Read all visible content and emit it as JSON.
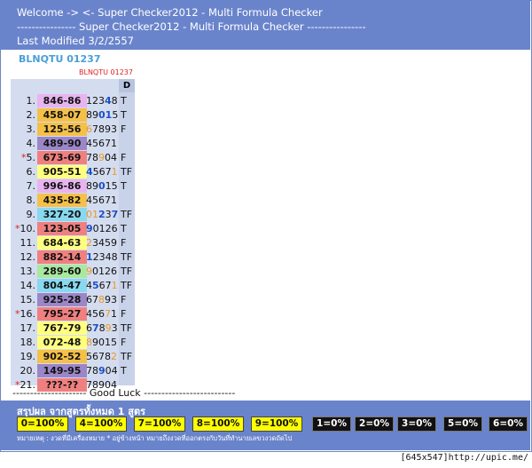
{
  "header": {
    "line1": "Welcome -> <- Super Checker2012 - Multi Formula Checker",
    "line2": "---------------- Super Checker2012 - Multi Formula Checker ----------------",
    "line3": "Last Modified 3/2/2557"
  },
  "formula_id": "BLNQTU 01237",
  "formula_id_small": "BLNQTU 01237",
  "column_header": "D",
  "rows": [
    {
      "n": "1.",
      "star": "",
      "pair": "846-86",
      "color": "#e8b4f0",
      "d": [
        "1",
        "2",
        "3",
        "4",
        "8"
      ],
      "h": [
        0,
        0,
        0,
        1,
        0
      ],
      "t": "T"
    },
    {
      "n": "2.",
      "star": "",
      "pair": "458-07",
      "color": "#f5c048",
      "d": [
        "8",
        "9",
        "0",
        "1",
        "5"
      ],
      "h": [
        0,
        0,
        1,
        1,
        0
      ],
      "t": "T"
    },
    {
      "n": "3.",
      "star": "",
      "pair": "125-56",
      "color": "#f5c048",
      "d": [
        "6",
        "7",
        "8",
        "9",
        "3"
      ],
      "h": [
        2,
        0,
        0,
        0,
        0
      ],
      "t": "F"
    },
    {
      "n": "4.",
      "star": "",
      "pair": "489-90",
      "color": "#9b86c8",
      "d": [
        "4",
        "5",
        "6",
        "7",
        "1"
      ],
      "h": [
        0,
        0,
        0,
        0,
        0
      ],
      "t": ""
    },
    {
      "n": "5.",
      "star": "*",
      "pair": "673-69",
      "color": "#f08080",
      "d": [
        "7",
        "8",
        "9",
        "0",
        "4"
      ],
      "h": [
        0,
        0,
        2,
        0,
        0
      ],
      "t": "F"
    },
    {
      "n": "6.",
      "star": "",
      "pair": "905-51",
      "color": "#ffff80",
      "d": [
        "4",
        "5",
        "6",
        "7",
        "1"
      ],
      "h": [
        1,
        0,
        0,
        0,
        2
      ],
      "t": "TF"
    },
    {
      "n": "7.",
      "star": "",
      "pair": "996-86",
      "color": "#e8b4f0",
      "d": [
        "8",
        "9",
        "0",
        "1",
        "5"
      ],
      "h": [
        0,
        0,
        1,
        0,
        0
      ],
      "t": "T"
    },
    {
      "n": "8.",
      "star": "",
      "pair": "435-82",
      "color": "#f5c048",
      "d": [
        "4",
        "5",
        "6",
        "7",
        "1"
      ],
      "h": [
        0,
        0,
        0,
        0,
        0
      ],
      "t": ""
    },
    {
      "n": "9.",
      "star": "",
      "pair": "327-20",
      "color": "#88d8f0",
      "d": [
        "0",
        "1",
        "2",
        "3",
        "7"
      ],
      "h": [
        2,
        2,
        1,
        0,
        1
      ],
      "t": "TF"
    },
    {
      "n": "10.",
      "star": "*",
      "pair": "123-05",
      "color": "#f08080",
      "d": [
        "9",
        "0",
        "1",
        "2",
        "6"
      ],
      "h": [
        1,
        0,
        0,
        0,
        0
      ],
      "t": "T"
    },
    {
      "n": "11.",
      "star": "",
      "pair": "684-63",
      "color": "#ffff80",
      "d": [
        "2",
        "3",
        "4",
        "5",
        "9"
      ],
      "h": [
        2,
        0,
        0,
        0,
        0
      ],
      "t": "F"
    },
    {
      "n": "12.",
      "star": "",
      "pair": "882-14",
      "color": "#f08080",
      "d": [
        "1",
        "2",
        "3",
        "4",
        "8"
      ],
      "h": [
        1,
        0,
        0,
        0,
        0
      ],
      "t": "TF"
    },
    {
      "n": "13.",
      "star": "",
      "pair": "289-60",
      "color": "#a8e8a0",
      "d": [
        "9",
        "0",
        "1",
        "2",
        "6"
      ],
      "h": [
        2,
        0,
        0,
        0,
        0
      ],
      "t": "TF"
    },
    {
      "n": "14.",
      "star": "",
      "pair": "804-47",
      "color": "#88d8f0",
      "d": [
        "4",
        "5",
        "6",
        "7",
        "1"
      ],
      "h": [
        0,
        1,
        0,
        0,
        2
      ],
      "t": "TF"
    },
    {
      "n": "15.",
      "star": "",
      "pair": "925-28",
      "color": "#9b86c8",
      "d": [
        "6",
        "7",
        "8",
        "9",
        "3"
      ],
      "h": [
        0,
        0,
        2,
        0,
        0
      ],
      "t": "F"
    },
    {
      "n": "16.",
      "star": "*",
      "pair": "795-27",
      "color": "#f08080",
      "d": [
        "4",
        "5",
        "6",
        "7",
        "1"
      ],
      "h": [
        0,
        0,
        0,
        2,
        0
      ],
      "t": "F"
    },
    {
      "n": "17.",
      "star": "",
      "pair": "767-79",
      "color": "#ffff80",
      "d": [
        "6",
        "7",
        "8",
        "9",
        "3"
      ],
      "h": [
        0,
        1,
        0,
        2,
        0
      ],
      "t": "TF"
    },
    {
      "n": "18.",
      "star": "",
      "pair": "072-48",
      "color": "#ffff80",
      "d": [
        "8",
        "9",
        "0",
        "1",
        "5"
      ],
      "h": [
        2,
        0,
        0,
        0,
        0
      ],
      "t": "F"
    },
    {
      "n": "19.",
      "star": "",
      "pair": "902-52",
      "color": "#f5c048",
      "d": [
        "5",
        "6",
        "7",
        "8",
        "2"
      ],
      "h": [
        0,
        0,
        0,
        0,
        2
      ],
      "t": "TF"
    },
    {
      "n": "20.",
      "star": "",
      "pair": "149-95",
      "color": "#9b86c8",
      "d": [
        "7",
        "8",
        "9",
        "0",
        "4"
      ],
      "h": [
        0,
        0,
        1,
        0,
        0
      ],
      "t": "T"
    },
    {
      "n": "21.",
      "star": "*",
      "pair": "???-??",
      "color": "#f08080",
      "d": [
        "7",
        "8",
        "9",
        "0",
        "4"
      ],
      "h": [
        0,
        0,
        0,
        0,
        0
      ],
      "t": ""
    }
  ],
  "good_luck": "--------------------- Good Luck --------------------------",
  "summary_title": "สรุปผล จากสูตรทั้งหมด 1 สูตร",
  "badges": [
    {
      "text": "0=100%",
      "style": "yb"
    },
    {
      "text": "4=100%",
      "style": "yb"
    },
    {
      "text": "7=100%",
      "style": "yb"
    },
    {
      "text": "8=100%",
      "style": "yb"
    },
    {
      "text": "9=100%",
      "style": "yb"
    },
    {
      "text": "1=0%",
      "style": "bb"
    },
    {
      "text": "2=0%",
      "style": "bb"
    },
    {
      "text": "3=0%",
      "style": "bb"
    },
    {
      "text": "5=0%",
      "style": "bb"
    },
    {
      "text": "6=0%",
      "style": "bb"
    }
  ],
  "note": "หมายเหตุ : งวดที่มีเครื่องหมาย * อยู่ข้างหน้า หมายถึงงวดที่ออกตรงกับวันที่ทำนายเลขวงวดถัดไป",
  "watermark": "[645x547]http://upic.me/"
}
